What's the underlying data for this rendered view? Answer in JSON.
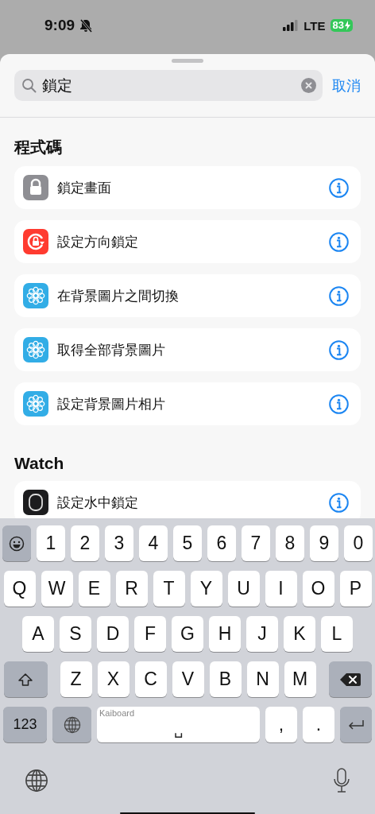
{
  "status_bar": {
    "time": "9:09",
    "network": "LTE",
    "battery": "83"
  },
  "search": {
    "value": "鎖定",
    "cancel": "取消"
  },
  "sections": [
    {
      "title": "程式碼",
      "items": [
        {
          "label": "鎖定畫面",
          "kind": "lock"
        },
        {
          "label": "設定方向鎖定",
          "kind": "rotation"
        },
        {
          "label": "在背景圖片之間切換",
          "kind": "wallpaper"
        },
        {
          "label": "取得全部背景圖片",
          "kind": "wallpaper"
        },
        {
          "label": "設定背景圖片相片",
          "kind": "wallpaper"
        }
      ]
    },
    {
      "title": "Watch",
      "items": [
        {
          "label": "設定水中鎖定",
          "kind": "watch"
        }
      ]
    }
  ],
  "keyboard": {
    "number_row": [
      "1",
      "2",
      "3",
      "4",
      "5",
      "6",
      "7",
      "8",
      "9",
      "0"
    ],
    "letter_rows": [
      [
        "Q",
        "W",
        "E",
        "R",
        "T",
        "Y",
        "U",
        "I",
        "O",
        "P"
      ],
      [
        "A",
        "S",
        "D",
        "F",
        "G",
        "H",
        "J",
        "K",
        "L"
      ],
      [
        "Z",
        "X",
        "C",
        "V",
        "B",
        "N",
        "M"
      ]
    ],
    "numbers_key": "123",
    "space_label": "Kaiboard",
    "space_glyph": "␣",
    "comma": ",",
    "period": "."
  }
}
